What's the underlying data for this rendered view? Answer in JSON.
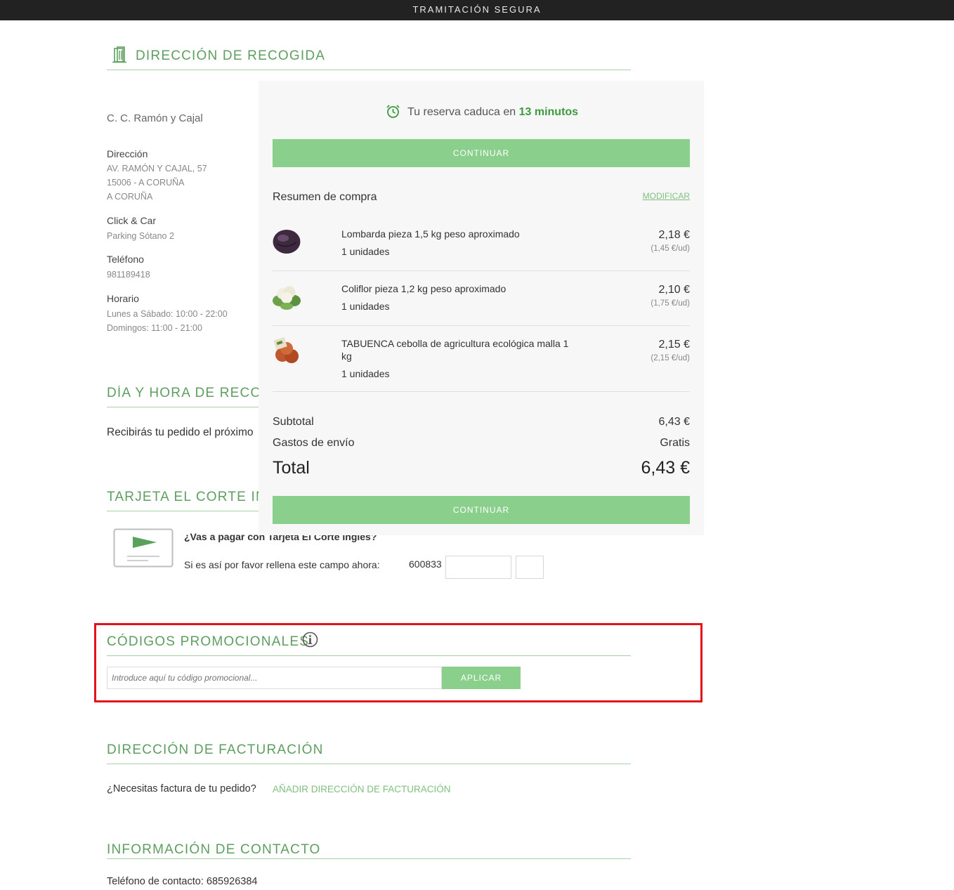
{
  "header": {
    "title": "TRAMITACIÓN SEGURA"
  },
  "pickup": {
    "section_title": "DIRECCIÓN DE RECOGIDA",
    "store_name": "C. C. Ramón y Cajal",
    "address_label": "Dirección",
    "address_lines": [
      "AV. RAMÓN Y CAJAL, 57",
      "15006 - A CORUÑA",
      "A CORUÑA"
    ],
    "clickcar_label": "Click & Car",
    "clickcar_value": "Parking Sótano 2",
    "phone_label": "Teléfono",
    "phone_value": "981189418",
    "hours_label": "Horario",
    "hours_lines": [
      "Lunes a Sábado: 10:00 - 22:00",
      "Domingos: 11:00 - 21:00"
    ]
  },
  "pickup_time": {
    "section_title": "DÍA Y HORA DE RECOGIDA",
    "text": "Recibirás tu pedido el próximo"
  },
  "card": {
    "section_title": "TARJETA EL CORTE INGLÉS",
    "question": "¿Vas a pagar con Tarjeta El Corte Inglés?",
    "instruction": "Si es así por favor rellena este campo ahora:",
    "prefix": "600833"
  },
  "promo": {
    "section_title": "CÓDIGOS PROMOCIONALES",
    "placeholder": "Introduce aquí tu código promocional...",
    "apply_label": "APLICAR"
  },
  "billing": {
    "section_title": "DIRECCIÓN DE FACTURACIÓN",
    "question": "¿Necesitas factura de tu pedido?",
    "link": "AÑADIR DIRECCIÓN DE FACTURACIÓN"
  },
  "contact": {
    "section_title": "INFORMACIÓN DE CONTACTO",
    "phone": "Teléfono de contacto: 685926384"
  },
  "summary": {
    "timer_prefix": "Tu reserva caduca en",
    "timer_value": "13 minutos",
    "continue_label": "CONTINUAR",
    "title": "Resumen de compra",
    "modify_label": "MODIFICAR",
    "items": [
      {
        "name": "Lombarda pieza 1,5 kg peso aproximado",
        "qty": "1 unidades",
        "price": "2,18 €",
        "unit": "(1,45 €/ud)"
      },
      {
        "name": "Coliflor pieza 1,2 kg peso aproximado",
        "qty": "1 unidades",
        "price": "2,10 €",
        "unit": "(1,75 €/ud)"
      },
      {
        "name_line1": "TABUENCA cebolla de agricultura ecológica malla 1",
        "name_line2": "kg",
        "qty": "1 unidades",
        "price": "2,15 €",
        "unit": "(2,15 €/ud)"
      }
    ],
    "subtotal_label": "Subtotal",
    "subtotal_value": "6,43 €",
    "shipping_label": "Gastos de envío",
    "shipping_value": "Gratis",
    "total_label": "Total",
    "total_value": "6,43 €"
  },
  "colors": {
    "accent": "#5e9e60",
    "button": "#8bcf8c",
    "highlight": "#e3131b"
  }
}
